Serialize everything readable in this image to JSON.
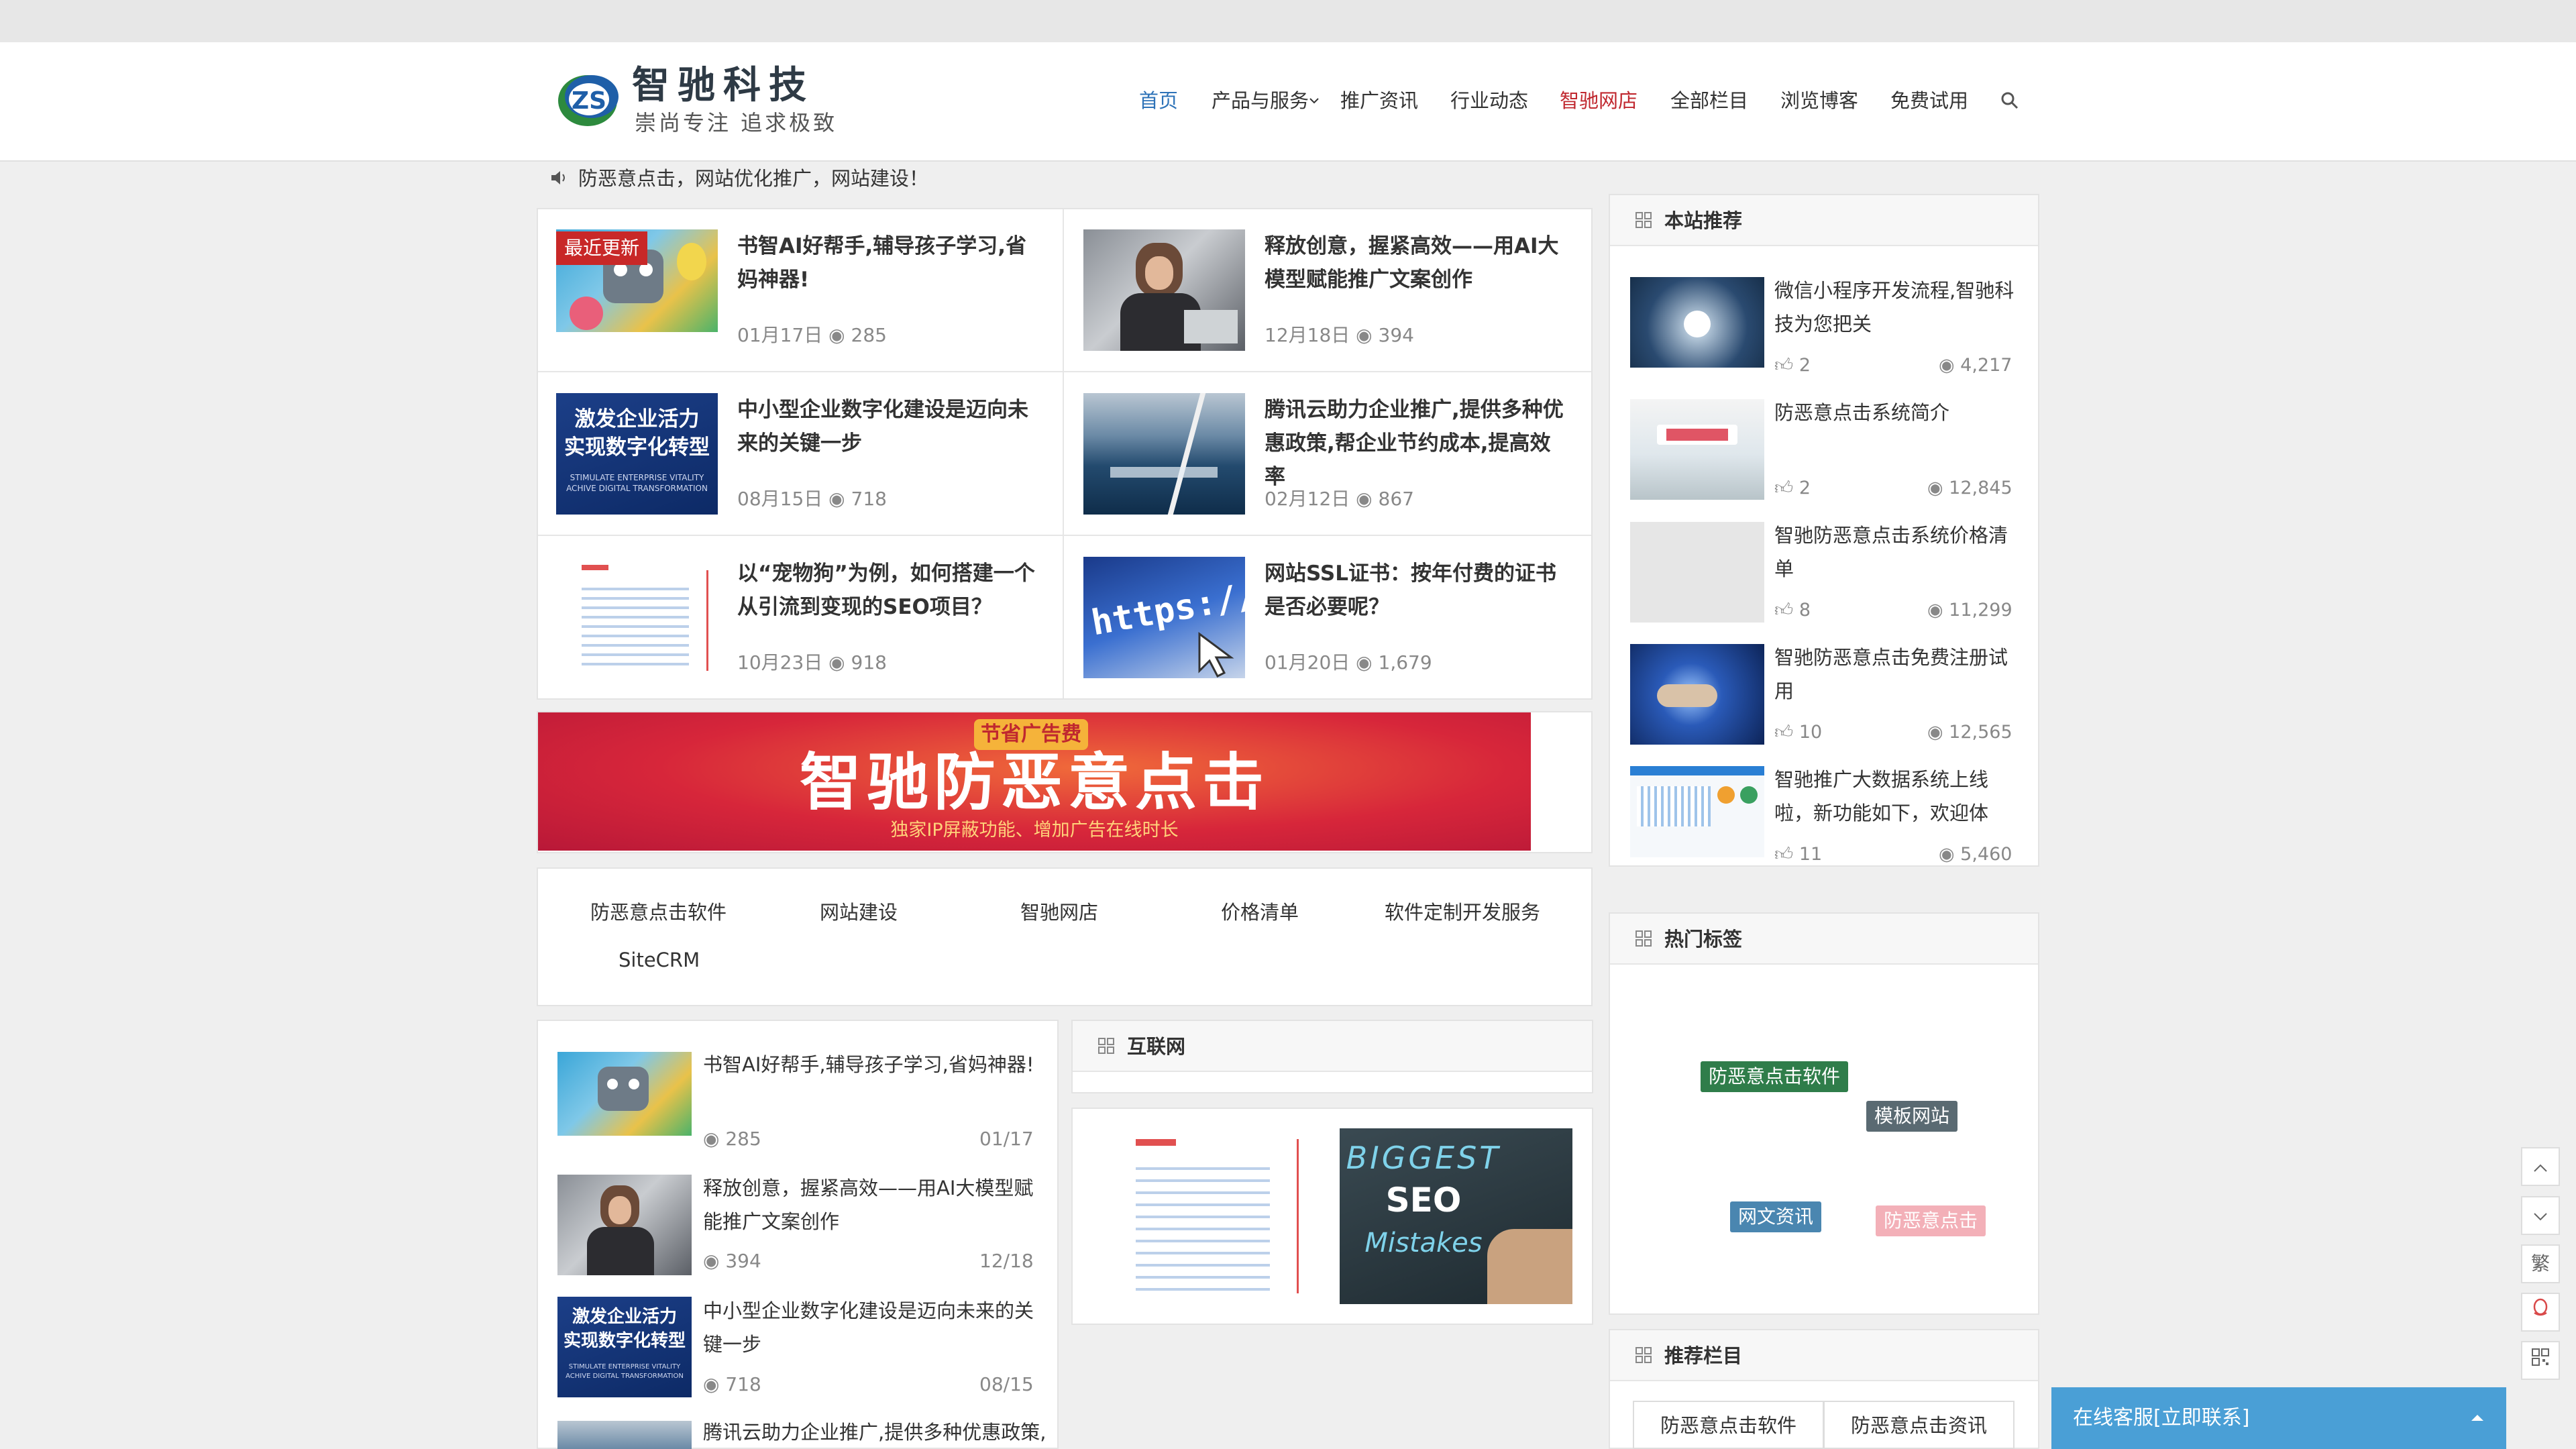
{
  "site": {
    "logo_text": "智驰科技",
    "slogan": "崇尚专注 追求极致"
  },
  "nav": {
    "items": [
      "首页",
      "产品与服务",
      "推广资讯",
      "行业动态",
      "智驰网店",
      "全部栏目",
      "浏览博客",
      "免费试用"
    ]
  },
  "notice": "防恶意点击，网站优化推广，网站建设！",
  "featured": {
    "badge": "最近更新",
    "items": [
      {
        "title": "书智AI好帮手,辅导孩子学习,省妈神器!",
        "date": "01月17日",
        "views": "285"
      },
      {
        "title": "释放创意，握紧高效——用AI大模型赋能推广文案创作",
        "date": "12月18日",
        "views": "394"
      },
      {
        "title": "中小型企业数字化建设是迈向未来的关键一步",
        "date": "08月15日",
        "views": "718"
      },
      {
        "title": "腾讯云助力企业推广,提供多种优惠政策,帮企业节约成本,提高效率",
        "date": "02月12日",
        "views": "867"
      },
      {
        "title": "以“宠物狗”为例，如何搭建一个从引流到变现的SEO项目？",
        "date": "10月23日",
        "views": "918"
      },
      {
        "title": "网站SSL证书：按年付费的证书是否必要呢？",
        "date": "01月20日",
        "views": "1,679"
      }
    ]
  },
  "image_text": {
    "digital_cn_1": "激发企业活力",
    "digital_cn_2": "实现数字化转型",
    "digital_en_1": "STIMULATE ENTERPRISE VITALITY",
    "digital_en_2": "ACHIVE DIGITAL TRANSFORMATION",
    "url_text": "https://www",
    "seo_1": "BIGGEST",
    "seo_2": "SEO",
    "seo_3": "Mistakes"
  },
  "banner": {
    "small": "节省广告费",
    "main": "智驰防恶意点击",
    "sub": "独家IP屏蔽功能、增加广告在线时长"
  },
  "quicklinks": [
    "防恶意点击软件",
    "网站建设",
    "智驰网店",
    "价格清单",
    "软件定制开发服务",
    "SiteCRM"
  ],
  "latest": {
    "items": [
      {
        "title": "书智AI好帮手,辅导孩子学习,省妈神器!",
        "views": "285",
        "date": "01/17"
      },
      {
        "title": "释放创意，握紧高效——用AI大模型赋能推广文案创作",
        "views": "394",
        "date": "12/18"
      },
      {
        "title": "中小型企业数字化建设是迈向未来的关键一步",
        "views": "718",
        "date": "08/15"
      },
      {
        "title": "腾讯云助力企业推广,提供多种优惠政策,"
      }
    ]
  },
  "internet": {
    "heading": "互联网"
  },
  "sidebar": {
    "recommend": {
      "heading": "本站推荐",
      "items": [
        {
          "title": "微信小程序开发流程,智驰科技为您把关",
          "likes": "2",
          "views": "4,217"
        },
        {
          "title": "防恶意点击系统简介",
          "likes": "2",
          "views": "12,845"
        },
        {
          "title": "智驰防恶意点击系统价格清单",
          "likes": "8",
          "views": "11,299"
        },
        {
          "title": "智驰防恶意点击免费注册试用",
          "likes": "10",
          "views": "12,565"
        },
        {
          "title": "智驰推广大数据系统上线啦，新功能如下，欢迎体",
          "likes": "11",
          "views": "5,460"
        }
      ]
    },
    "tags": {
      "heading": "热门标签",
      "items": [
        "防恶意点击软件",
        "模板网站",
        "网文资讯",
        "防恶意点击"
      ]
    },
    "columns": {
      "heading": "推荐栏目",
      "items": [
        "防恶意点击软件",
        "防恶意点击资讯"
      ]
    }
  },
  "side_buttons": {
    "traditional": "繁"
  },
  "kefu": {
    "label": "在线客服[立即联系]"
  },
  "colors": {
    "accent": "#2e73b8",
    "red": "#c0282f",
    "tag_green": "#2f7d4a",
    "tag_gray": "#5a6a72",
    "tag_blue": "#4a86b0",
    "tag_pink": "#f3b0b8"
  }
}
